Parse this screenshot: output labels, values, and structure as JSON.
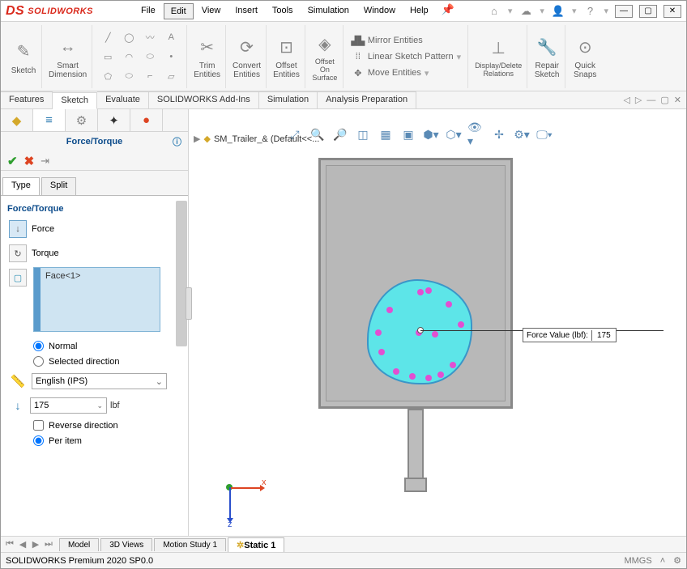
{
  "app": {
    "brand_ds": "DS",
    "brand_name": "SOLIDWORKS"
  },
  "menu": {
    "file": "File",
    "edit": "Edit",
    "view": "View",
    "insert": "Insert",
    "tools": "Tools",
    "simulation": "Simulation",
    "window": "Window",
    "help": "Help"
  },
  "ribbon": {
    "sketch": "Sketch",
    "smart_dim": "Smart\nDimension",
    "trim": "Trim\nEntities",
    "convert": "Convert\nEntities",
    "offset": "Offset\nEntities",
    "offset_surface": "Offset\nOn\nSurface",
    "mirror": "Mirror Entities",
    "linear_pattern": "Linear Sketch Pattern",
    "move": "Move Entities",
    "disp_del": "Display/Delete\nRelations",
    "repair": "Repair\nSketch",
    "quick_snaps": "Quick\nSnaps"
  },
  "cmd_tabs": {
    "features": "Features",
    "sketch": "Sketch",
    "evaluate": "Evaluate",
    "addins": "SOLIDWORKS Add-Ins",
    "simulation": "Simulation",
    "analysis": "Analysis Preparation"
  },
  "panel": {
    "title": "Force/Torque",
    "tab_type": "Type",
    "tab_split": "Split",
    "section": "Force/Torque",
    "force": "Force",
    "torque": "Torque",
    "selection": "Face<1>",
    "normal": "Normal",
    "selected_dir": "Selected direction",
    "units": "English (IPS)",
    "value": "175",
    "value_unit": "lbf",
    "reverse": "Reverse direction",
    "per_item": "Per item"
  },
  "tree": {
    "root": "SM_Trailer_& (Default<<..."
  },
  "callout": {
    "label": "Force Value (lbf):",
    "value": "175"
  },
  "triad": {
    "x": "x",
    "z": "z"
  },
  "bottom_tabs": {
    "model": "Model",
    "views3d": "3D Views",
    "motion": "Motion Study 1",
    "static": "Static 1"
  },
  "status": {
    "text": "SOLIDWORKS Premium 2020 SP0.0",
    "units": "MMGS"
  }
}
